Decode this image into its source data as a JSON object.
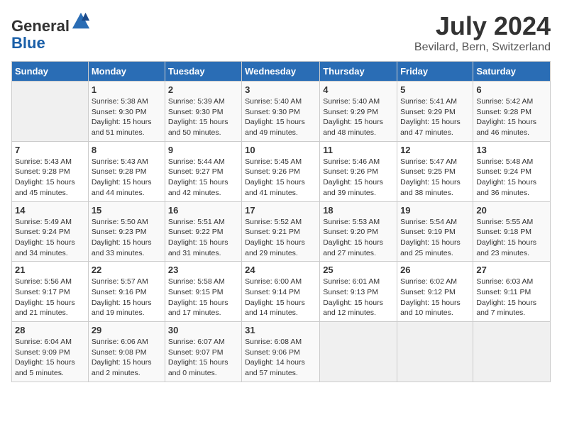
{
  "header": {
    "logo_line1": "General",
    "logo_line2": "Blue",
    "month_year": "July 2024",
    "location": "Bevilard, Bern, Switzerland"
  },
  "weekdays": [
    "Sunday",
    "Monday",
    "Tuesday",
    "Wednesday",
    "Thursday",
    "Friday",
    "Saturday"
  ],
  "weeks": [
    [
      {
        "day": "",
        "info": ""
      },
      {
        "day": "1",
        "info": "Sunrise: 5:38 AM\nSunset: 9:30 PM\nDaylight: 15 hours\nand 51 minutes."
      },
      {
        "day": "2",
        "info": "Sunrise: 5:39 AM\nSunset: 9:30 PM\nDaylight: 15 hours\nand 50 minutes."
      },
      {
        "day": "3",
        "info": "Sunrise: 5:40 AM\nSunset: 9:30 PM\nDaylight: 15 hours\nand 49 minutes."
      },
      {
        "day": "4",
        "info": "Sunrise: 5:40 AM\nSunset: 9:29 PM\nDaylight: 15 hours\nand 48 minutes."
      },
      {
        "day": "5",
        "info": "Sunrise: 5:41 AM\nSunset: 9:29 PM\nDaylight: 15 hours\nand 47 minutes."
      },
      {
        "day": "6",
        "info": "Sunrise: 5:42 AM\nSunset: 9:28 PM\nDaylight: 15 hours\nand 46 minutes."
      }
    ],
    [
      {
        "day": "7",
        "info": "Sunrise: 5:43 AM\nSunset: 9:28 PM\nDaylight: 15 hours\nand 45 minutes."
      },
      {
        "day": "8",
        "info": "Sunrise: 5:43 AM\nSunset: 9:28 PM\nDaylight: 15 hours\nand 44 minutes."
      },
      {
        "day": "9",
        "info": "Sunrise: 5:44 AM\nSunset: 9:27 PM\nDaylight: 15 hours\nand 42 minutes."
      },
      {
        "day": "10",
        "info": "Sunrise: 5:45 AM\nSunset: 9:26 PM\nDaylight: 15 hours\nand 41 minutes."
      },
      {
        "day": "11",
        "info": "Sunrise: 5:46 AM\nSunset: 9:26 PM\nDaylight: 15 hours\nand 39 minutes."
      },
      {
        "day": "12",
        "info": "Sunrise: 5:47 AM\nSunset: 9:25 PM\nDaylight: 15 hours\nand 38 minutes."
      },
      {
        "day": "13",
        "info": "Sunrise: 5:48 AM\nSunset: 9:24 PM\nDaylight: 15 hours\nand 36 minutes."
      }
    ],
    [
      {
        "day": "14",
        "info": "Sunrise: 5:49 AM\nSunset: 9:24 PM\nDaylight: 15 hours\nand 34 minutes."
      },
      {
        "day": "15",
        "info": "Sunrise: 5:50 AM\nSunset: 9:23 PM\nDaylight: 15 hours\nand 33 minutes."
      },
      {
        "day": "16",
        "info": "Sunrise: 5:51 AM\nSunset: 9:22 PM\nDaylight: 15 hours\nand 31 minutes."
      },
      {
        "day": "17",
        "info": "Sunrise: 5:52 AM\nSunset: 9:21 PM\nDaylight: 15 hours\nand 29 minutes."
      },
      {
        "day": "18",
        "info": "Sunrise: 5:53 AM\nSunset: 9:20 PM\nDaylight: 15 hours\nand 27 minutes."
      },
      {
        "day": "19",
        "info": "Sunrise: 5:54 AM\nSunset: 9:19 PM\nDaylight: 15 hours\nand 25 minutes."
      },
      {
        "day": "20",
        "info": "Sunrise: 5:55 AM\nSunset: 9:18 PM\nDaylight: 15 hours\nand 23 minutes."
      }
    ],
    [
      {
        "day": "21",
        "info": "Sunrise: 5:56 AM\nSunset: 9:17 PM\nDaylight: 15 hours\nand 21 minutes."
      },
      {
        "day": "22",
        "info": "Sunrise: 5:57 AM\nSunset: 9:16 PM\nDaylight: 15 hours\nand 19 minutes."
      },
      {
        "day": "23",
        "info": "Sunrise: 5:58 AM\nSunset: 9:15 PM\nDaylight: 15 hours\nand 17 minutes."
      },
      {
        "day": "24",
        "info": "Sunrise: 6:00 AM\nSunset: 9:14 PM\nDaylight: 15 hours\nand 14 minutes."
      },
      {
        "day": "25",
        "info": "Sunrise: 6:01 AM\nSunset: 9:13 PM\nDaylight: 15 hours\nand 12 minutes."
      },
      {
        "day": "26",
        "info": "Sunrise: 6:02 AM\nSunset: 9:12 PM\nDaylight: 15 hours\nand 10 minutes."
      },
      {
        "day": "27",
        "info": "Sunrise: 6:03 AM\nSunset: 9:11 PM\nDaylight: 15 hours\nand 7 minutes."
      }
    ],
    [
      {
        "day": "28",
        "info": "Sunrise: 6:04 AM\nSunset: 9:09 PM\nDaylight: 15 hours\nand 5 minutes."
      },
      {
        "day": "29",
        "info": "Sunrise: 6:06 AM\nSunset: 9:08 PM\nDaylight: 15 hours\nand 2 minutes."
      },
      {
        "day": "30",
        "info": "Sunrise: 6:07 AM\nSunset: 9:07 PM\nDaylight: 15 hours\nand 0 minutes."
      },
      {
        "day": "31",
        "info": "Sunrise: 6:08 AM\nSunset: 9:06 PM\nDaylight: 14 hours\nand 57 minutes."
      },
      {
        "day": "",
        "info": ""
      },
      {
        "day": "",
        "info": ""
      },
      {
        "day": "",
        "info": ""
      }
    ]
  ]
}
